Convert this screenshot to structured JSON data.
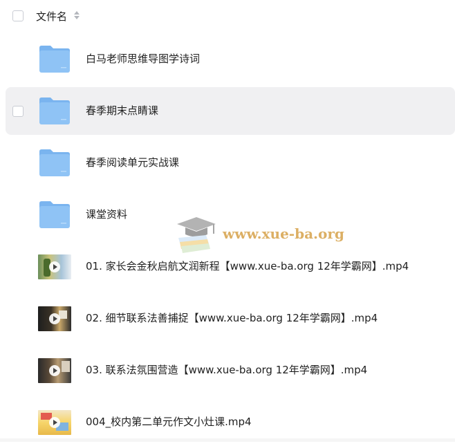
{
  "header": {
    "title": "文件名"
  },
  "files": [
    {
      "name": "白马老师思维导图学诗词",
      "type": "folder"
    },
    {
      "name": "春季期末点睛课",
      "type": "folder"
    },
    {
      "name": "春季阅读单元实战课",
      "type": "folder"
    },
    {
      "name": "课堂资料",
      "type": "folder"
    },
    {
      "name": "01. 家长会金秋启航文润新程【www.xue-ba.org 12年学霸网】.mp4",
      "type": "video"
    },
    {
      "name": "02. 细节联系法善捕捉【www.xue-ba.org 12年学霸网】.mp4",
      "type": "video"
    },
    {
      "name": "03. 联系法氛围营造【www.xue-ba.org 12年学霸网】.mp4",
      "type": "video"
    },
    {
      "name": "004_校内第二单元作文小灶课.mp4",
      "type": "video"
    }
  ],
  "watermark": {
    "text": "www.xue-ba.org"
  },
  "colors": {
    "folder": "#8fc3f5",
    "folder_tab": "#7ab4ef",
    "hover_row": "#f0f0f2",
    "watermark": "#d6a24a"
  }
}
